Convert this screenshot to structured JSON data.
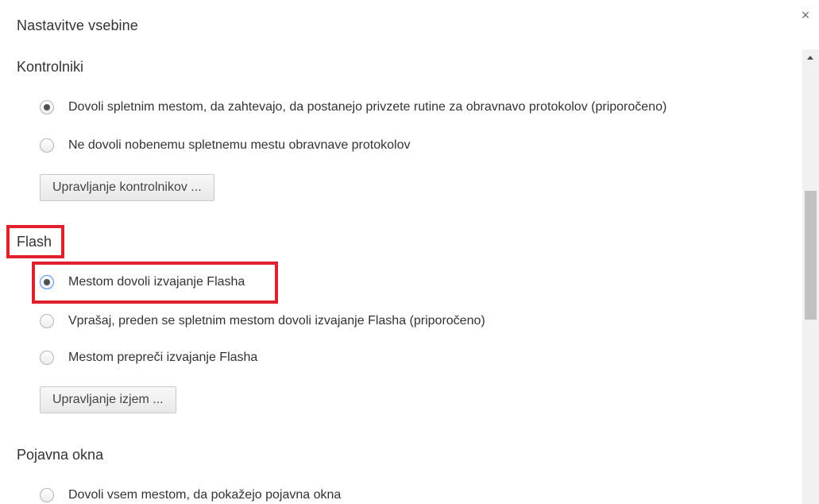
{
  "dialog": {
    "title": "Nastavitve vsebine",
    "close_label": "×"
  },
  "handlers": {
    "heading": "Kontrolniki",
    "options": [
      {
        "label": "Dovoli spletnim mestom, da zahtevajo, da postanejo privzete rutine za obravnavo protokolov (priporočeno)",
        "checked": true
      },
      {
        "label": "Ne dovoli nobenemu spletnemu mestu obravnave protokolov",
        "checked": false
      }
    ],
    "manage_button": "Upravljanje kontrolnikov ..."
  },
  "flash": {
    "heading": "Flash",
    "options": [
      {
        "label": "Mestom dovoli izvajanje Flasha",
        "checked": true
      },
      {
        "label": "Vprašaj, preden se spletnim mestom dovoli izvajanje Flasha (priporočeno)",
        "checked": false
      },
      {
        "label": "Mestom prepreči izvajanje Flasha",
        "checked": false
      }
    ],
    "manage_button": "Upravljanje izjem ..."
  },
  "popups": {
    "heading": "Pojavna okna",
    "options": [
      {
        "label": "Dovoli vsem mestom, da pokažejo pojavna okna",
        "checked": false
      }
    ]
  },
  "colors": {
    "highlight": "#e0202d",
    "focus": "#4d90fe"
  },
  "icons": {
    "close": "close-icon",
    "scroll_up": "scroll-up-arrow-icon"
  }
}
